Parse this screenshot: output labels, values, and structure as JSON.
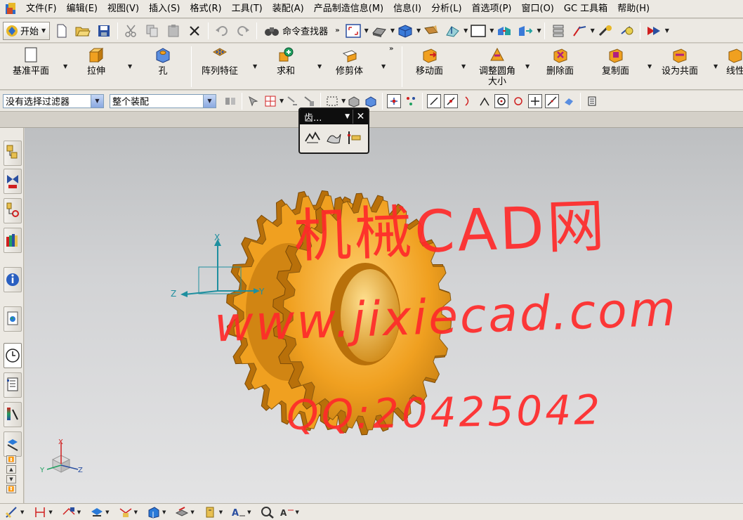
{
  "menu": [
    "文件(F)",
    "编辑(E)",
    "视图(V)",
    "插入(S)",
    "格式(R)",
    "工具(T)",
    "装配(A)",
    "产品制造信息(M)",
    "信息(I)",
    "分析(L)",
    "首选项(P)",
    "窗口(O)",
    "GC 工具箱",
    "帮助(H)"
  ],
  "standard_toolbar": {
    "start_label": "开始",
    "command_finder_label": "命令查找器"
  },
  "feature_toolbar": [
    {
      "label": "基准平面",
      "icon": "datum-plane-icon"
    },
    {
      "label": "拉伸",
      "icon": "extrude-icon"
    },
    {
      "label": "孔",
      "icon": "hole-icon"
    },
    {
      "label": "阵列特征",
      "icon": "pattern-feature-icon"
    },
    {
      "label": "求和",
      "icon": "unite-icon"
    },
    {
      "label": "修剪体",
      "icon": "trim-body-icon"
    },
    {
      "label": "移动面",
      "icon": "move-face-icon"
    },
    {
      "label": "调整圆角大小",
      "icon": "resize-blend-icon"
    },
    {
      "label": "删除面",
      "icon": "delete-face-icon"
    },
    {
      "label": "复制面",
      "icon": "copy-face-icon"
    },
    {
      "label": "设为共面",
      "icon": "make-coplanar-icon"
    },
    {
      "label": "线性",
      "icon": "linear-dimension-icon"
    }
  ],
  "selection_bar": {
    "type_filter": "没有选择过滤器",
    "scope": "整个装配"
  },
  "floating_palette": {
    "title": "齿..."
  },
  "watermark": {
    "line1": "机械CAD网",
    "line2": "www.jixiecad.com",
    "line3": "QQ:20425042"
  },
  "csys": {
    "x": "X",
    "y": "Y",
    "z": "Z"
  },
  "colors": {
    "gear": "#f0a020",
    "gear_dark": "#b8700a",
    "watermark": "#ff2a2a",
    "csys_axis": "#1f8f9f"
  }
}
